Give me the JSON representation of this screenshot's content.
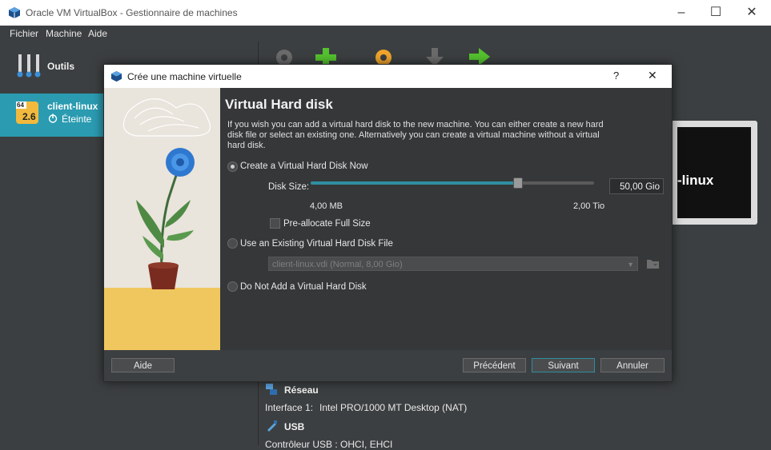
{
  "window": {
    "title": "Oracle VM VirtualBox - Gestionnaire de machines"
  },
  "menu": {
    "items": [
      "Fichier",
      "Machine",
      "Aide"
    ]
  },
  "sidebar": {
    "tools_label": "Outils",
    "vm": {
      "name": "client-linux",
      "state": "Éteinte",
      "badge_top": "64",
      "badge_version": "2.6"
    }
  },
  "preview": {
    "vm_name_partial": "-linux"
  },
  "dialog": {
    "title": "Crée une machine virtuelle",
    "help_glyph": "?",
    "close_glyph": "✕",
    "heading": "Virtual Hard disk",
    "description": "If you wish you can add a virtual hard disk to the new machine. You can either create a new hard disk file or select an existing one. Alternatively you can create a virtual machine without a virtual hard disk.",
    "options": {
      "create_now": {
        "label": "Create a Virtual Hard Disk Now",
        "selected": true
      },
      "use_existing": {
        "label": "Use an Existing Virtual Hard Disk File",
        "selected": false
      },
      "no_disk": {
        "label": "Do Not Add a Virtual Hard Disk",
        "selected": false
      }
    },
    "disk_size": {
      "label": "Disk Size:",
      "value": "50,00 Gio",
      "min_label": "4,00 MB",
      "max_label": "2,00 Tio",
      "slider_fraction": 0.73
    },
    "preallocate": {
      "label": "Pre-allocate Full Size",
      "checked": false
    },
    "existing_file": {
      "value": "client-linux.vdi (Normal, 8,00 Gio)"
    },
    "buttons": {
      "help": "Aide",
      "back": "Précédent",
      "next": "Suivant",
      "cancel": "Annuler"
    }
  },
  "details": {
    "network": {
      "title": "Réseau",
      "interface_label": "Interface 1:",
      "interface_value": "Intel PRO/1000 MT Desktop (NAT)"
    },
    "usb": {
      "title": "USB",
      "controller_partial": "Contrôleur USB : OHCI, EHCI"
    }
  },
  "colors": {
    "selection": "#2a9bb1",
    "accent": "#2f8ea0",
    "dialog_bg": "#353739"
  }
}
